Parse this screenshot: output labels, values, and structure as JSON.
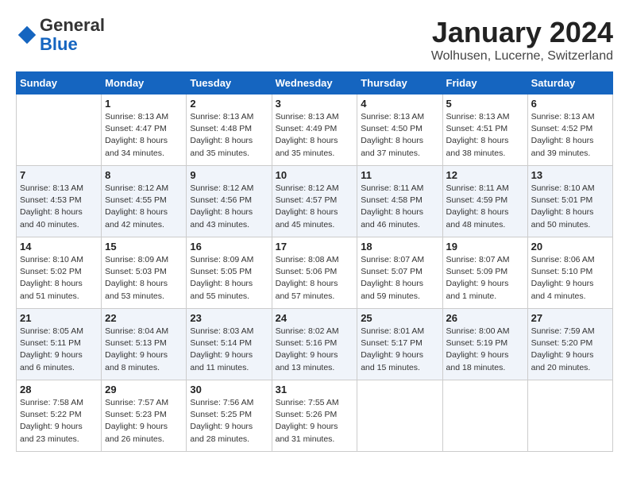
{
  "header": {
    "logo_general": "General",
    "logo_blue": "Blue",
    "title": "January 2024",
    "subtitle": "Wolhusen, Lucerne, Switzerland"
  },
  "weekdays": [
    "Sunday",
    "Monday",
    "Tuesday",
    "Wednesday",
    "Thursday",
    "Friday",
    "Saturday"
  ],
  "weeks": [
    [
      {
        "day": "",
        "sunrise": "",
        "sunset": "",
        "daylight": ""
      },
      {
        "day": "1",
        "sunrise": "Sunrise: 8:13 AM",
        "sunset": "Sunset: 4:47 PM",
        "daylight": "Daylight: 8 hours and 34 minutes."
      },
      {
        "day": "2",
        "sunrise": "Sunrise: 8:13 AM",
        "sunset": "Sunset: 4:48 PM",
        "daylight": "Daylight: 8 hours and 35 minutes."
      },
      {
        "day": "3",
        "sunrise": "Sunrise: 8:13 AM",
        "sunset": "Sunset: 4:49 PM",
        "daylight": "Daylight: 8 hours and 35 minutes."
      },
      {
        "day": "4",
        "sunrise": "Sunrise: 8:13 AM",
        "sunset": "Sunset: 4:50 PM",
        "daylight": "Daylight: 8 hours and 37 minutes."
      },
      {
        "day": "5",
        "sunrise": "Sunrise: 8:13 AM",
        "sunset": "Sunset: 4:51 PM",
        "daylight": "Daylight: 8 hours and 38 minutes."
      },
      {
        "day": "6",
        "sunrise": "Sunrise: 8:13 AM",
        "sunset": "Sunset: 4:52 PM",
        "daylight": "Daylight: 8 hours and 39 minutes."
      }
    ],
    [
      {
        "day": "7",
        "sunrise": "Sunrise: 8:13 AM",
        "sunset": "Sunset: 4:53 PM",
        "daylight": "Daylight: 8 hours and 40 minutes."
      },
      {
        "day": "8",
        "sunrise": "Sunrise: 8:12 AM",
        "sunset": "Sunset: 4:55 PM",
        "daylight": "Daylight: 8 hours and 42 minutes."
      },
      {
        "day": "9",
        "sunrise": "Sunrise: 8:12 AM",
        "sunset": "Sunset: 4:56 PM",
        "daylight": "Daylight: 8 hours and 43 minutes."
      },
      {
        "day": "10",
        "sunrise": "Sunrise: 8:12 AM",
        "sunset": "Sunset: 4:57 PM",
        "daylight": "Daylight: 8 hours and 45 minutes."
      },
      {
        "day": "11",
        "sunrise": "Sunrise: 8:11 AM",
        "sunset": "Sunset: 4:58 PM",
        "daylight": "Daylight: 8 hours and 46 minutes."
      },
      {
        "day": "12",
        "sunrise": "Sunrise: 8:11 AM",
        "sunset": "Sunset: 4:59 PM",
        "daylight": "Daylight: 8 hours and 48 minutes."
      },
      {
        "day": "13",
        "sunrise": "Sunrise: 8:10 AM",
        "sunset": "Sunset: 5:01 PM",
        "daylight": "Daylight: 8 hours and 50 minutes."
      }
    ],
    [
      {
        "day": "14",
        "sunrise": "Sunrise: 8:10 AM",
        "sunset": "Sunset: 5:02 PM",
        "daylight": "Daylight: 8 hours and 51 minutes."
      },
      {
        "day": "15",
        "sunrise": "Sunrise: 8:09 AM",
        "sunset": "Sunset: 5:03 PM",
        "daylight": "Daylight: 8 hours and 53 minutes."
      },
      {
        "day": "16",
        "sunrise": "Sunrise: 8:09 AM",
        "sunset": "Sunset: 5:05 PM",
        "daylight": "Daylight: 8 hours and 55 minutes."
      },
      {
        "day": "17",
        "sunrise": "Sunrise: 8:08 AM",
        "sunset": "Sunset: 5:06 PM",
        "daylight": "Daylight: 8 hours and 57 minutes."
      },
      {
        "day": "18",
        "sunrise": "Sunrise: 8:07 AM",
        "sunset": "Sunset: 5:07 PM",
        "daylight": "Daylight: 8 hours and 59 minutes."
      },
      {
        "day": "19",
        "sunrise": "Sunrise: 8:07 AM",
        "sunset": "Sunset: 5:09 PM",
        "daylight": "Daylight: 9 hours and 1 minute."
      },
      {
        "day": "20",
        "sunrise": "Sunrise: 8:06 AM",
        "sunset": "Sunset: 5:10 PM",
        "daylight": "Daylight: 9 hours and 4 minutes."
      }
    ],
    [
      {
        "day": "21",
        "sunrise": "Sunrise: 8:05 AM",
        "sunset": "Sunset: 5:11 PM",
        "daylight": "Daylight: 9 hours and 6 minutes."
      },
      {
        "day": "22",
        "sunrise": "Sunrise: 8:04 AM",
        "sunset": "Sunset: 5:13 PM",
        "daylight": "Daylight: 9 hours and 8 minutes."
      },
      {
        "day": "23",
        "sunrise": "Sunrise: 8:03 AM",
        "sunset": "Sunset: 5:14 PM",
        "daylight": "Daylight: 9 hours and 11 minutes."
      },
      {
        "day": "24",
        "sunrise": "Sunrise: 8:02 AM",
        "sunset": "Sunset: 5:16 PM",
        "daylight": "Daylight: 9 hours and 13 minutes."
      },
      {
        "day": "25",
        "sunrise": "Sunrise: 8:01 AM",
        "sunset": "Sunset: 5:17 PM",
        "daylight": "Daylight: 9 hours and 15 minutes."
      },
      {
        "day": "26",
        "sunrise": "Sunrise: 8:00 AM",
        "sunset": "Sunset: 5:19 PM",
        "daylight": "Daylight: 9 hours and 18 minutes."
      },
      {
        "day": "27",
        "sunrise": "Sunrise: 7:59 AM",
        "sunset": "Sunset: 5:20 PM",
        "daylight": "Daylight: 9 hours and 20 minutes."
      }
    ],
    [
      {
        "day": "28",
        "sunrise": "Sunrise: 7:58 AM",
        "sunset": "Sunset: 5:22 PM",
        "daylight": "Daylight: 9 hours and 23 minutes."
      },
      {
        "day": "29",
        "sunrise": "Sunrise: 7:57 AM",
        "sunset": "Sunset: 5:23 PM",
        "daylight": "Daylight: 9 hours and 26 minutes."
      },
      {
        "day": "30",
        "sunrise": "Sunrise: 7:56 AM",
        "sunset": "Sunset: 5:25 PM",
        "daylight": "Daylight: 9 hours and 28 minutes."
      },
      {
        "day": "31",
        "sunrise": "Sunrise: 7:55 AM",
        "sunset": "Sunset: 5:26 PM",
        "daylight": "Daylight: 9 hours and 31 minutes."
      },
      {
        "day": "",
        "sunrise": "",
        "sunset": "",
        "daylight": ""
      },
      {
        "day": "",
        "sunrise": "",
        "sunset": "",
        "daylight": ""
      },
      {
        "day": "",
        "sunrise": "",
        "sunset": "",
        "daylight": ""
      }
    ]
  ]
}
